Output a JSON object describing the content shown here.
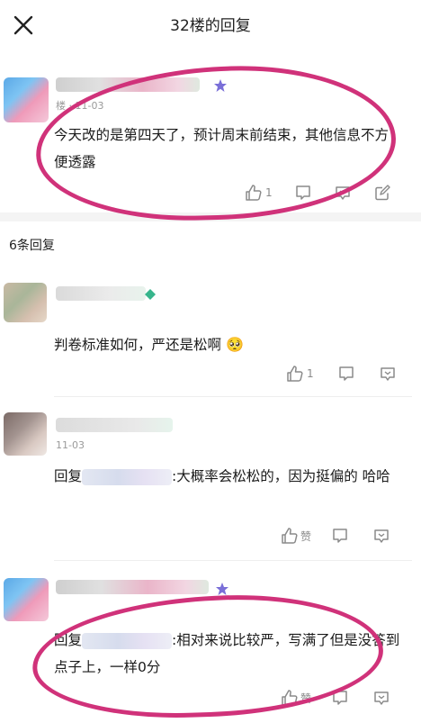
{
  "header": {
    "title": "32楼的回复"
  },
  "main_comment": {
    "meta": "楼 · 11-03",
    "text": "今天改的是第四天了，预计周末前结束，其他信息不方便透露",
    "like_count": "1"
  },
  "replies_section": {
    "title": "6条回复"
  },
  "replies": [
    {
      "text": "判卷标准如何，严还是松啊",
      "emoji": "🥺",
      "like_label": "1",
      "meta": ""
    },
    {
      "reply_prefix": "回复",
      "text": ":大概率会松松的，因为挺偏的 哈哈",
      "like_label": "赞",
      "meta": "11-03"
    },
    {
      "reply_prefix": "回复",
      "text": ":相对来说比较严，写满了但是没答到点子上，一样0分",
      "like_label": "赞",
      "meta": ""
    }
  ],
  "colors": {
    "annotation": "#d0327a",
    "divider": "#f4f4f4",
    "text": "#1a1a1a",
    "meta": "#9a9a9a"
  }
}
